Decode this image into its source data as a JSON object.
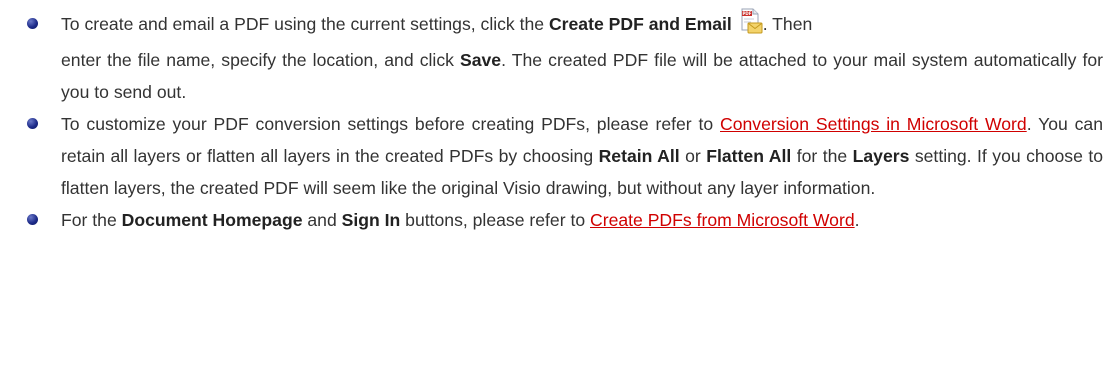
{
  "items": [
    {
      "t1": "To create and email a PDF using the current settings, click the ",
      "b1": "Create PDF and Email",
      "icon": "pdf-email-icon",
      "t2": ". Then",
      "t3": "enter the file name, specify the location, and click ",
      "b2": "Save",
      "t4": ". The created PDF file will be attached to your mail system automatically for you to send out."
    },
    {
      "t1": "To customize your PDF conversion settings before creating PDFs, please refer to ",
      "link": "Conversion Settings in Microsoft Word",
      "t2": ". You can retain all layers or flatten all layers in the created PDFs by choosing ",
      "b1": "Retain All",
      "t3": " or ",
      "b2": "Flatten All",
      "t4": " for the ",
      "b3": "Layers",
      "t5": " setting. If you choose to flatten layers, the created PDF will seem like the original Visio drawing, but without any layer information."
    },
    {
      "t1": "For the ",
      "b1": "Document Homepage",
      "t2": " and ",
      "b2": "Sign In",
      "t3": " buttons, please refer to ",
      "link": "Create PDFs from Microsoft Word",
      "t4": "."
    }
  ],
  "colors": {
    "link": "#d00000",
    "bullet": "#1e2c8a",
    "text": "#333333"
  }
}
